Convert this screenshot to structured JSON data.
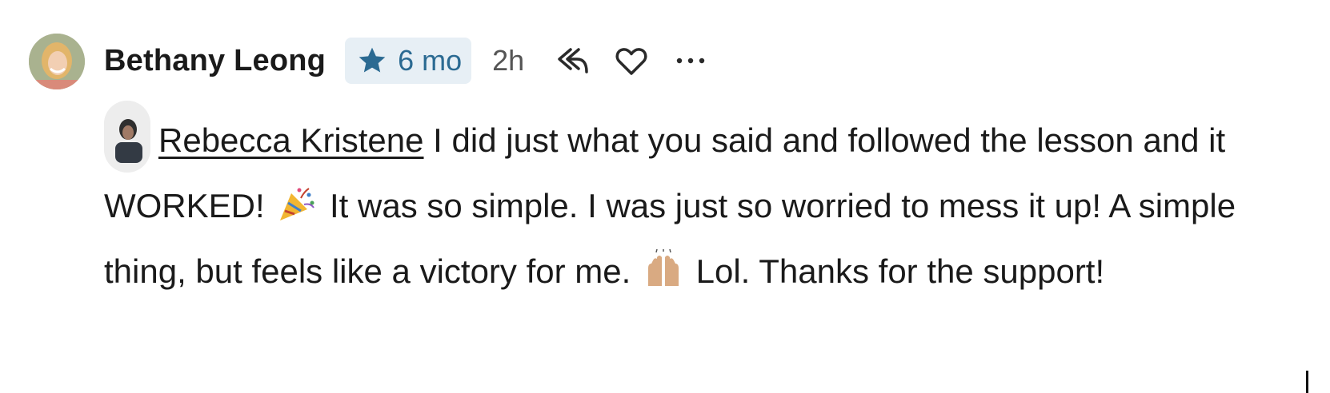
{
  "comment": {
    "author": "Bethany Leong",
    "tenure_badge": "6 mo",
    "time": "2h",
    "mention": "Rebecca Kristene",
    "text_part1": " I did just what you said and followed the lesson and it WORKED! ",
    "emoji1": "party-popper-emoji",
    "text_part2": " It was so simple. I was just so worried to mess it up! A simple thing, but feels like a victory for me. ",
    "emoji2": "raising-hands-emoji",
    "text_part3": " Lol. Thanks for the support!"
  },
  "actions": {
    "reply_icon": "reply-icon",
    "like_icon": "heart-icon",
    "more_icon": "more-icon"
  },
  "colors": {
    "badge_bg": "#e7eff5",
    "badge_accent": "#2b6a92",
    "text": "#1a1a1a",
    "muted": "#555555"
  }
}
